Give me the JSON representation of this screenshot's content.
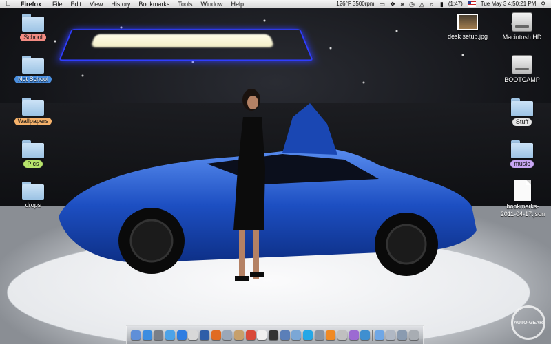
{
  "menubar": {
    "app_name": "Firefox",
    "menus": [
      "File",
      "Edit",
      "View",
      "History",
      "Bookmarks",
      "Tools",
      "Window",
      "Help"
    ],
    "status": {
      "temp_fan": "126°F 3500rpm",
      "battery": "(1:47)",
      "datetime": "Tue May 3  4:50:21 PM"
    }
  },
  "desktop_icons_left": [
    {
      "label": "School",
      "tag_color": "#f28b82"
    },
    {
      "label": "Not School",
      "tag_color": "#4a8fe0"
    },
    {
      "label": "Wallpapers",
      "tag_color": "#f6b26b"
    },
    {
      "label": "Pics",
      "tag_color": "#b7e36b"
    },
    {
      "label": "drops",
      "tag_color": ""
    }
  ],
  "desktop_icons_right": [
    {
      "label": "desk setup.jpg",
      "kind": "image"
    },
    {
      "label": "Macintosh HD",
      "kind": "drive"
    },
    {
      "label": "BOOTCAMP",
      "kind": "drive"
    },
    {
      "label": "Stuff",
      "kind": "folder",
      "tag_color": "#e6e6e6"
    },
    {
      "label": "music",
      "kind": "folder",
      "tag_color": "#c9a6f3"
    },
    {
      "label": "bookmarks-2011-04-17.json",
      "kind": "document"
    }
  ],
  "dock": {
    "icons": [
      "finder-icon",
      "app-store-icon",
      "launchpad-icon",
      "system-icon",
      "safari-icon",
      "calendar-icon",
      "itunes-icon",
      "firefox-icon",
      "preview-icon",
      "photos-icon",
      "ical-icon",
      "textedit-icon",
      "terminal-icon",
      "xcode-icon",
      "mail-icon",
      "skype-icon",
      "network-icon",
      "vlc-icon",
      "app-icon-a",
      "app-icon-b",
      "app-icon-c",
      "downloads-icon",
      "documents-icon",
      "applications-icon",
      "trash-icon"
    ],
    "colors": [
      "#5f8fd8",
      "#3b8de0",
      "#7a7f88",
      "#4da3e8",
      "#2f7de1",
      "#d8d8d8",
      "#2f5ea8",
      "#e06b22",
      "#9aa7b8",
      "#c7a06b",
      "#d94a3a",
      "#f0f0f0",
      "#333333",
      "#5b7fb8",
      "#7ba7d6",
      "#25a7e6",
      "#8b95a3",
      "#f08a24",
      "#c0c0c0",
      "#9c6ad2",
      "#3f8fd0",
      "#6fa7e6",
      "#b0b8c4",
      "#8a9bb0",
      "#a8adb3"
    ]
  },
  "watermark_text": "AUTO-GEAR"
}
